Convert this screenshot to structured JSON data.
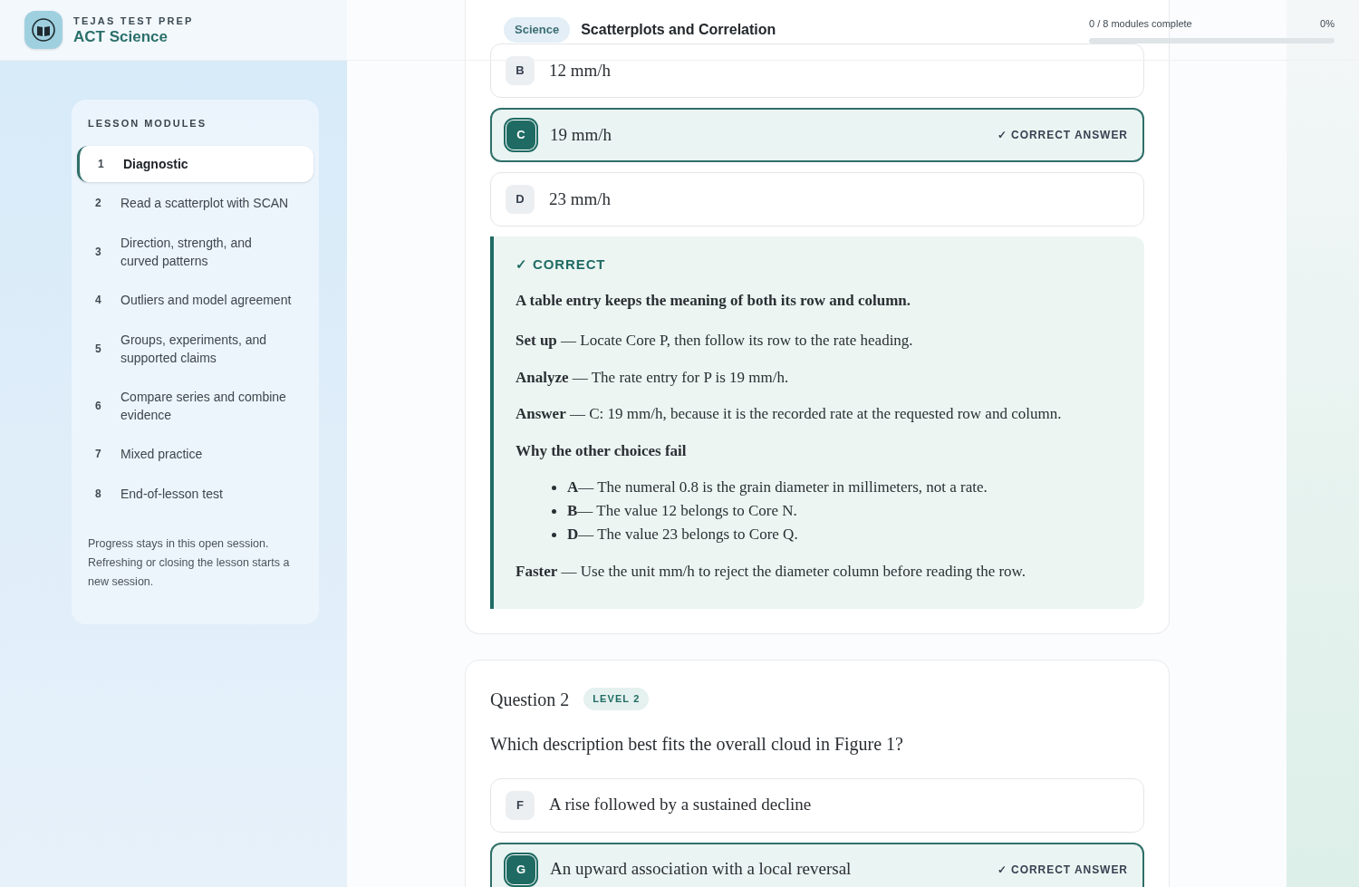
{
  "header": {
    "brand_top": "TEJAS TEST PREP",
    "brand": "ACT Science",
    "subject_tag": "Science",
    "lesson_title": "Scatterplots and Correlation",
    "progress_text": "0 / 8 modules complete",
    "progress_percent": "0%",
    "level": 0
  },
  "sidebar": {
    "heading": "LESSON MODULES",
    "modules": [
      {
        "number": "1",
        "label": "Diagnostic",
        "selected": true
      },
      {
        "number": "2",
        "label": "Read a scatterplot with SCAN",
        "selected": false
      },
      {
        "number": "3",
        "label": "Direction, strength, and curved patterns",
        "selected": false
      },
      {
        "number": "4",
        "label": "Outliers and model agreement",
        "selected": false
      },
      {
        "number": "5",
        "label": "Groups, experiments, and supported claims",
        "selected": false
      },
      {
        "number": "6",
        "label": "Compare series and combine evidence",
        "selected": false
      },
      {
        "number": "7",
        "label": "Mixed practice",
        "selected": false
      },
      {
        "number": "8",
        "label": "End-of-lesson test",
        "selected": false
      }
    ],
    "note": "Progress stays in this open session. Refreshing or closing the lesson starts a new session."
  },
  "questions": [
    {
      "options": [
        {
          "letter": "B",
          "text": "12 mm/h",
          "correct": false
        },
        {
          "letter": "C",
          "text": "19 mm/h",
          "correct": true,
          "marker": "✓ CORRECT ANSWER"
        },
        {
          "letter": "D",
          "text": "23 mm/h",
          "correct": false
        }
      ],
      "feedback": {
        "status": "✓ CORRECT",
        "kind": "correct",
        "lead": "A table entry keeps the meaning of both its row and column.",
        "steps": [
          "**Set up** — Locate Core P, then follow its row to the rate heading.",
          "**Analyze** — The rate entry for P is 19 mm/h.",
          "**Answer** — C: 19 mm/h, because it is the recorded rate at the requested row and column."
        ],
        "why_heading": "Why the other choices fail",
        "why": [
          "**A**— The numeral 0.8 is the grain diameter in millimeters, not a rate.",
          "**B**— The value 12 belongs to Core N.",
          "**D**— The value 23 belongs to Core Q."
        ],
        "faster": "**Faster** — Use the unit mm/h to reject the diameter column before reading the row."
      }
    },
    {
      "title": "Question 2",
      "level_badge": "LEVEL 2",
      "prompt": "Which description best fits the overall cloud in Figure 1?",
      "options": [
        {
          "letter": "F",
          "text": "A rise followed by a sustained decline",
          "correct": false
        },
        {
          "letter": "G",
          "text": "An upward association with a local reversal",
          "correct": true,
          "marker": "✓ CORRECT ANSWER"
        }
      ]
    }
  ]
}
